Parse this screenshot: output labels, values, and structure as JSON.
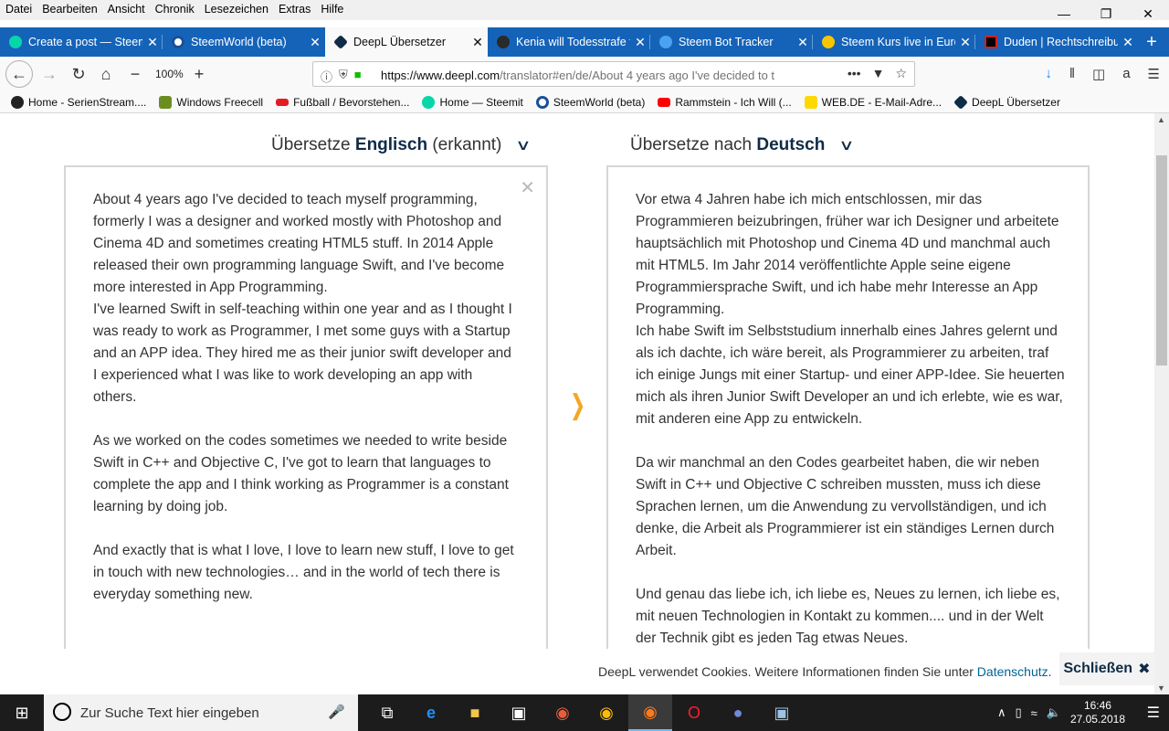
{
  "menubar": {
    "items": [
      "Datei",
      "Bearbeiten",
      "Ansicht",
      "Chronik",
      "Lesezeichen",
      "Extras",
      "Hilfe"
    ]
  },
  "tabs": [
    {
      "label": "Create a post — Steemit",
      "color": "#06d6a9"
    },
    {
      "label": "SteemWorld (beta)",
      "color": "#1a5099"
    },
    {
      "label": "DeepL Übersetzer",
      "color": "#0f2b46",
      "active": true
    },
    {
      "label": "Kenia will Todesstrafe für",
      "color": "#2a2a2a"
    },
    {
      "label": "Steem Bot Tracker",
      "color": "#4ba2f2"
    },
    {
      "label": "Steem Kurs live in Euro",
      "color": "#f7c600"
    },
    {
      "label": "Duden | Rechtschreibung",
      "color": "#d71e1e"
    }
  ],
  "navbar": {
    "zoom": "100%",
    "url_host": "https://www.deepl.com",
    "url_path": "/translator#en/de/About 4 years ago I've decided to t"
  },
  "bookmarks": [
    {
      "label": "Home - SerienStream....",
      "color": "#222222"
    },
    {
      "label": "Windows Freecell",
      "color": "#6b8e23"
    },
    {
      "label": "Fußball / Bevorstehen...",
      "color": "#e31b23"
    },
    {
      "label": "Home — Steemit",
      "color": "#06d6a9"
    },
    {
      "label": "SteemWorld (beta)",
      "color": "#1a5099"
    },
    {
      "label": "Rammstein - Ich Will (...",
      "color": "#ff0000"
    },
    {
      "label": "WEB.DE - E-Mail-Adre...",
      "color": "#ffd800"
    },
    {
      "label": "DeepL Übersetzer",
      "color": "#0f2b46"
    }
  ],
  "translator": {
    "source_prefix": "Übersetze",
    "source_lang": "Englisch",
    "source_suffix": "(erkannt)",
    "target_prefix": "Übersetze nach",
    "target_lang": "Deutsch",
    "source_paragraphs": [
      "About 4 years ago I've decided to teach myself programming, formerly I was a designer and worked mostly with Photoshop and Cinema 4D and sometimes creating HTML5 stuff. In 2014 Apple released their own programming language Swift, and I've become more interested in App Programming.",
      "I've learned Swift in self-teaching within one year and as I thought I was ready to work as Programmer, I met some guys with a Startup and an APP idea. They hired me as their junior swift developer and I experienced what I was like to work developing an app with others.",
      "As we worked on the codes sometimes we needed to write beside Swift in C++ and Objective C, I've got to learn that languages to complete the app and I think working as Programmer is a constant learning by doing job.",
      "And exactly that is what I love, I love to learn new stuff, I love to get in touch with new technologies… and in the world of tech there is everyday something new."
    ],
    "target_paragraphs": [
      "Vor etwa 4 Jahren habe ich mich entschlossen, mir das Programmieren beizubringen, früher war ich Designer und arbeitete hauptsächlich mit Photoshop und Cinema 4D und manchmal auch mit HTML5. Im Jahr 2014 veröffentlichte Apple seine eigene Programmiersprache Swift, und ich habe mehr Interesse an App Programming.",
      "Ich habe Swift im Selbststudium innerhalb eines Jahres gelernt und als ich dachte, ich wäre bereit, als Programmierer zu arbeiten, traf ich einige Jungs mit einer Startup- und einer APP-Idee. Sie heuerten mich als ihren Junior Swift Developer an und ich erlebte, wie es war, mit anderen eine App zu entwickeln.",
      "Da wir manchmal an den Codes gearbeitet haben, die wir neben Swift in C++ und Objective C schreiben mussten, muss ich diese Sprachen lernen, um die Anwendung zu vervollständigen, und ich denke, die Arbeit als Programmierer ist ein ständiges Lernen durch Arbeit.",
      "Und genau das liebe ich, ich liebe es, Neues zu lernen, ich liebe es, mit neuen Technologien in Kontakt zu kommen.... und in der Welt der Technik gibt es jeden Tag etwas Neues."
    ]
  },
  "cookie": {
    "text": "DeepL verwendet Cookies. Weitere Informationen finden Sie unter",
    "link": "Datenschutz",
    "suffix": ".",
    "close_label": "Schließen"
  },
  "taskbar": {
    "search_placeholder": "Zur Suche Text hier eingeben",
    "time": "16:46",
    "date": "27.05.2018"
  },
  "colors": {
    "deepl_blue": "#0f2b46",
    "accent_orange": "#f5a623",
    "tabstrip": "#1563b8"
  }
}
